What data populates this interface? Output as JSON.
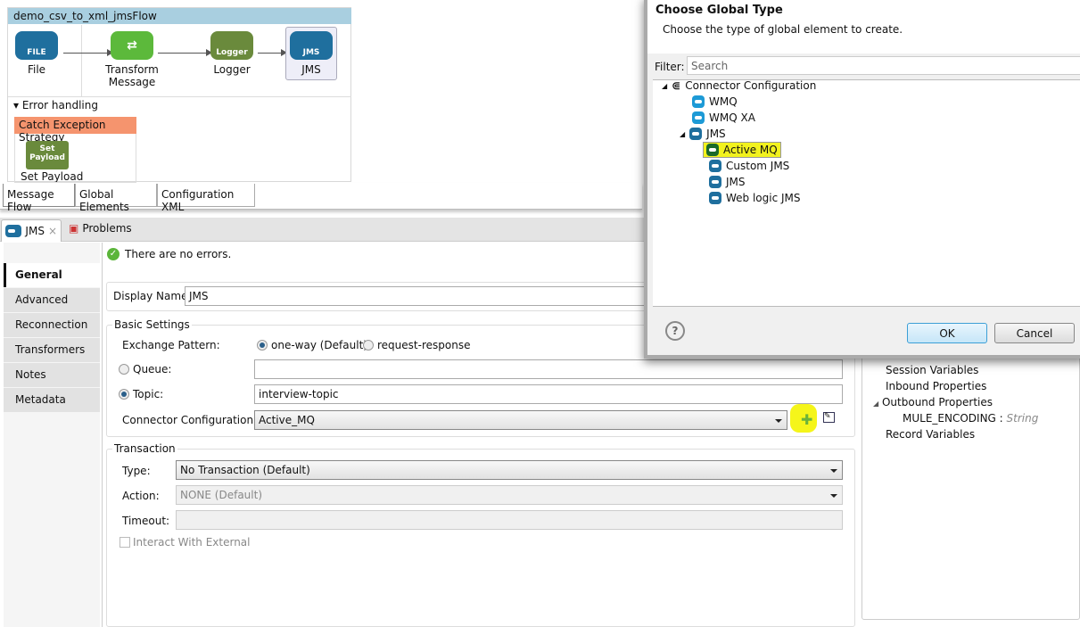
{
  "flow": {
    "title": "demo_csv_to_xml_jmsFlow",
    "nodes": [
      {
        "label": "File",
        "icon_text": "FILE"
      },
      {
        "label": "Transform Message",
        "icon_text": ""
      },
      {
        "label": "Logger",
        "icon_text": "Logger"
      },
      {
        "label": "JMS",
        "icon_text": "JMS"
      }
    ],
    "error_handling": "Error handling",
    "catch_strategy": "Catch Exception Strategy",
    "set_payload": {
      "label": "Set Payload",
      "icon_text": "Set Payload"
    }
  },
  "editor_tabs": [
    "Message Flow",
    "Global Elements",
    "Configuration XML"
  ],
  "panel_tabs": [
    {
      "label": "JMS"
    },
    {
      "label": "Problems"
    }
  ],
  "sidebar": [
    "General",
    "Advanced",
    "Reconnection",
    "Transformers",
    "Notes",
    "Metadata"
  ],
  "status": "There are no errors.",
  "form": {
    "display_name_label": "Display Name:",
    "display_name": "JMS",
    "basic_settings": "Basic Settings",
    "exchange_pattern_label": "Exchange Pattern:",
    "exchange_options": [
      "one-way (Default)",
      "request-response"
    ],
    "queue_label": "Queue:",
    "queue_value": "",
    "topic_label": "Topic:",
    "topic_value": "interview-topic",
    "connector_label": "Connector Configuration:",
    "connector_value": "Active_MQ",
    "transaction": "Transaction",
    "type_label": "Type:",
    "type_value": "No Transaction (Default)",
    "action_label": "Action:",
    "action_value": "NONE (Default)",
    "timeout_label": "Timeout:",
    "timeout_value": "",
    "interact_label": "Interact With External"
  },
  "right_panel": {
    "items": [
      "Session Variables",
      "Inbound Properties",
      "Outbound Properties",
      "Record Variables"
    ],
    "sub_key": "MULE_ENCODING",
    "sub_sep": ":",
    "sub_type": "String"
  },
  "dialog": {
    "title": "Choose Global Type",
    "subtitle": "Choose the type of global element to create.",
    "filter_label": "Filter:",
    "filter_placeholder": "Search",
    "tree": {
      "root": "Connector Configuration",
      "items": [
        "WMQ",
        "WMQ XA",
        "JMS"
      ],
      "jms_children": [
        "Active MQ",
        "Custom JMS",
        "JMS",
        "Web logic JMS"
      ]
    },
    "ok": "OK",
    "cancel": "Cancel"
  }
}
